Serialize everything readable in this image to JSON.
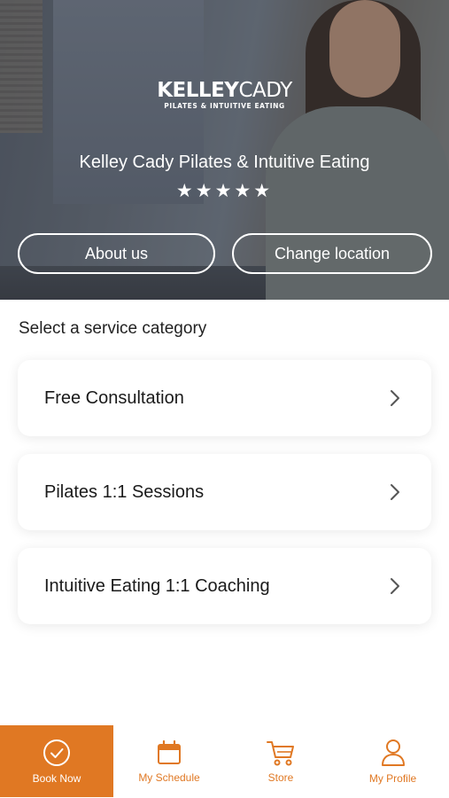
{
  "brand": {
    "logo_main_bold": "KELLEY",
    "logo_main_thin": "CADY",
    "logo_sub": "PILATES & INTUITIVE EATING"
  },
  "hero": {
    "title": "Kelley Cady Pilates & Intuitive Eating",
    "rating_stars": "★★★★★",
    "rating": 5,
    "about_label": "About us",
    "change_location_label": "Change location"
  },
  "services": {
    "heading": "Select a service category",
    "items": [
      {
        "label": "Free Consultation",
        "icon": "chevron-right-icon"
      },
      {
        "label": "Pilates 1:1 Sessions",
        "icon": "chevron-right-icon"
      },
      {
        "label": "Intuitive Eating 1:1 Coaching",
        "icon": "chevron-right-icon"
      }
    ]
  },
  "tabbar": {
    "accent_color": "#e07823",
    "tabs": [
      {
        "label": "Book Now",
        "icon": "check-circle-icon",
        "active": true
      },
      {
        "label": "My Schedule",
        "icon": "calendar-icon",
        "active": false
      },
      {
        "label": "Store",
        "icon": "cart-icon",
        "active": false
      },
      {
        "label": "My Profile",
        "icon": "profile-icon",
        "active": false
      }
    ]
  }
}
